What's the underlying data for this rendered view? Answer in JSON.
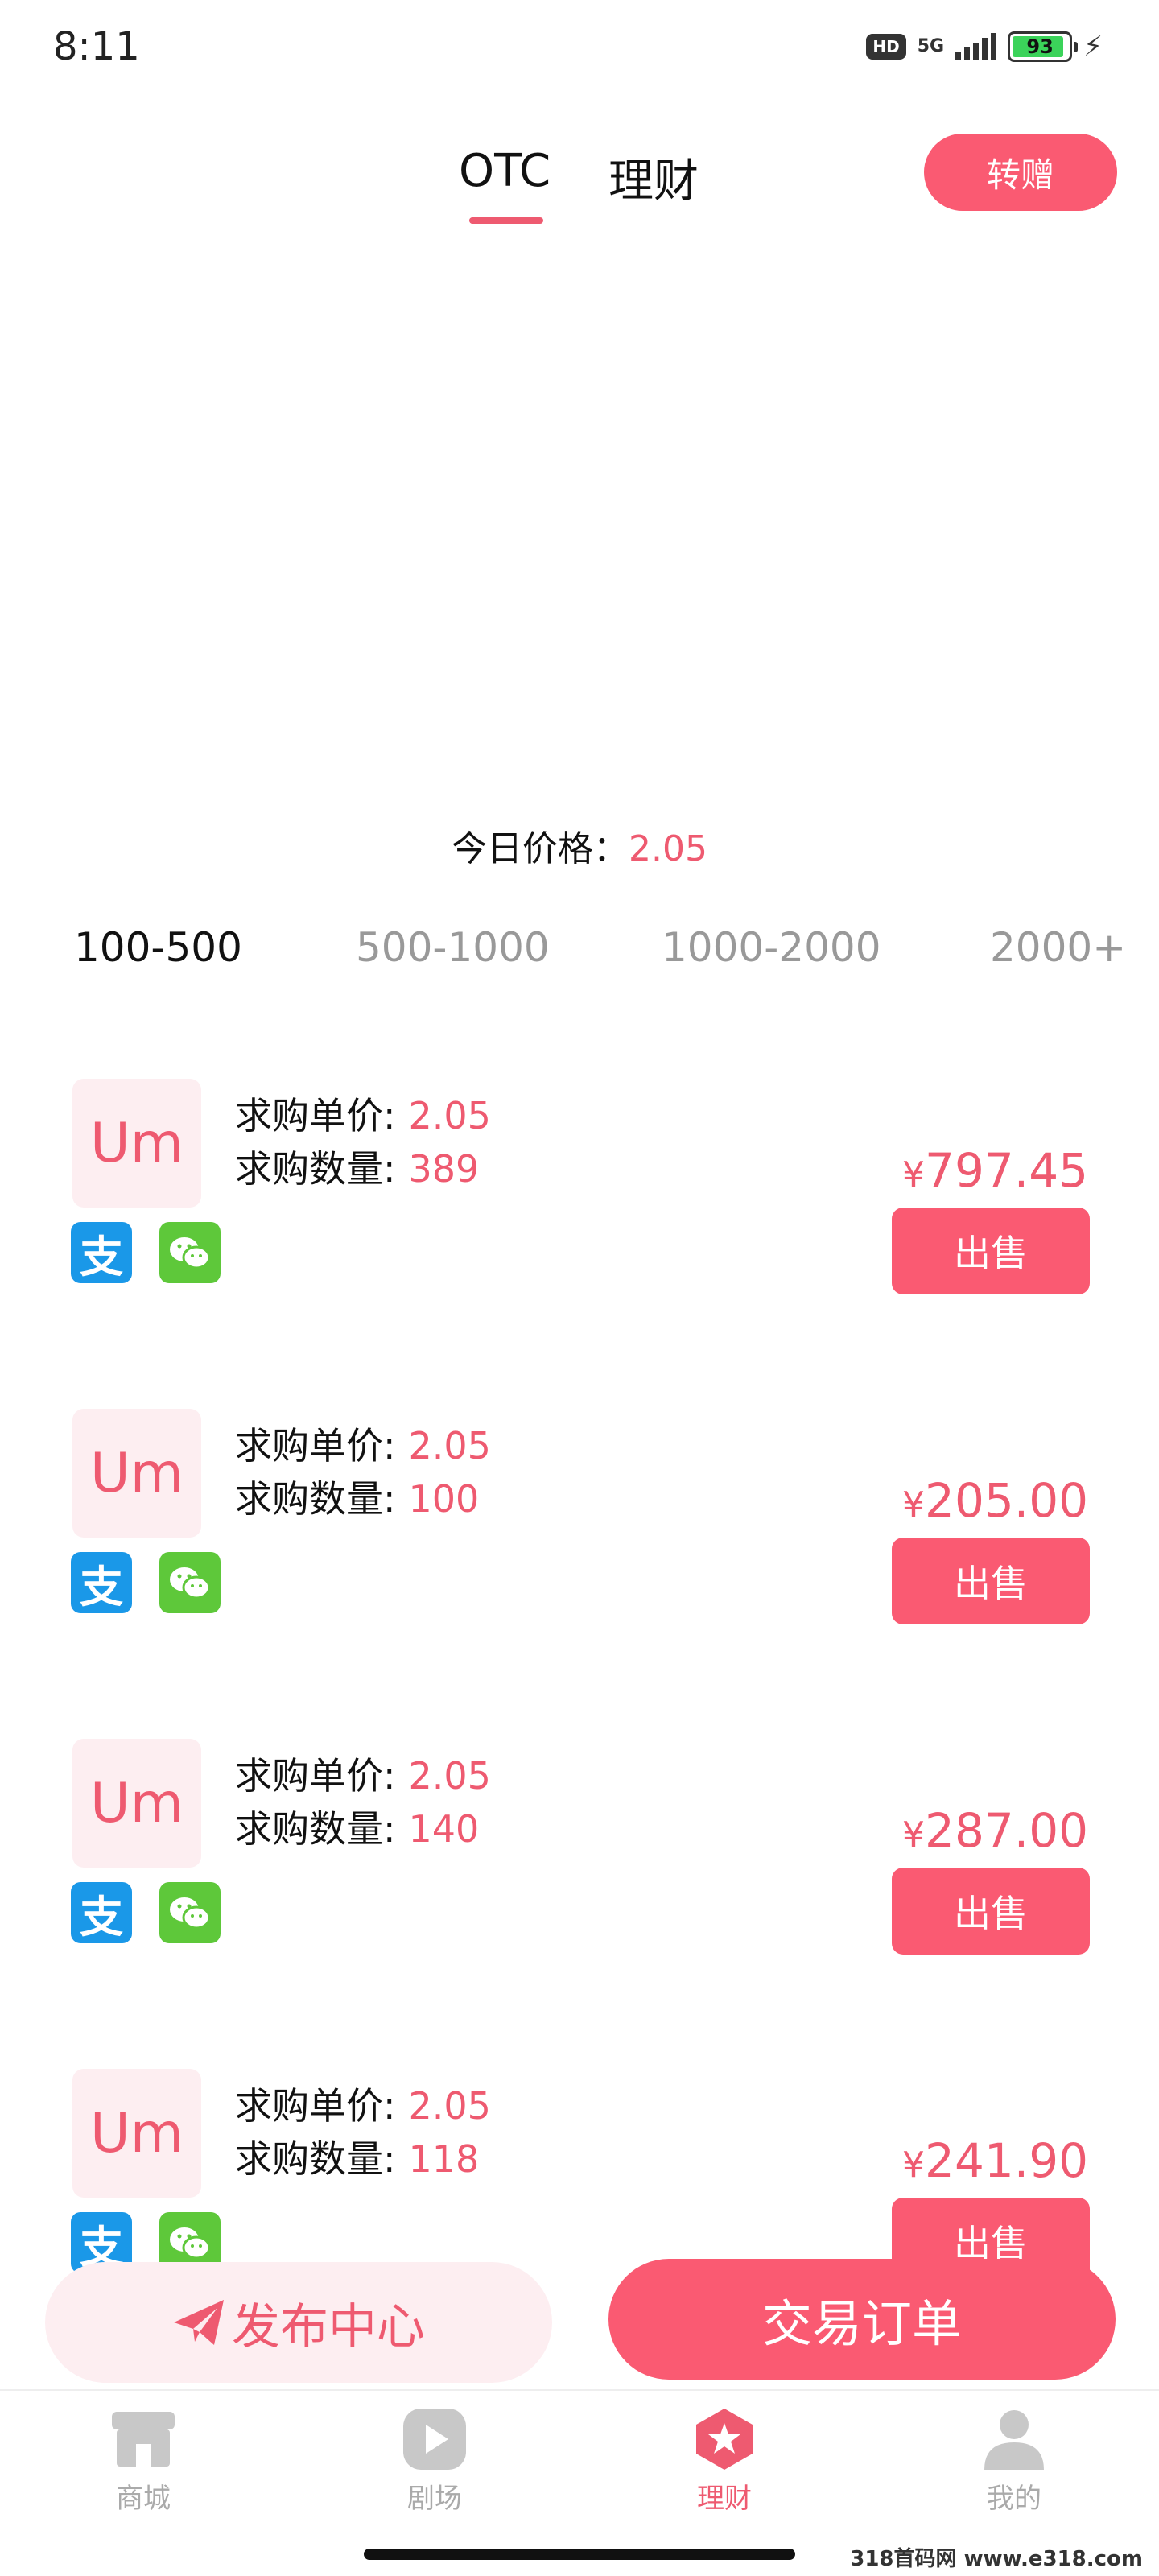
{
  "status_bar": {
    "time": "8:11",
    "hd": "HD",
    "network": "5G",
    "battery": "93",
    "battery_level_percent": 93
  },
  "header": {
    "tabs": [
      {
        "label": "OTC",
        "active": true
      },
      {
        "label": "理财",
        "active": false
      }
    ],
    "gift_label": "转赠"
  },
  "price": {
    "label": "今日价格：",
    "value": "2.05"
  },
  "ranges": [
    {
      "label": "100-500",
      "active": true
    },
    {
      "label": "500-1000",
      "active": false
    },
    {
      "label": "1000-2000",
      "active": false
    },
    {
      "label": "2000+",
      "active": false
    }
  ],
  "orders": [
    {
      "avatar": "Um",
      "unit_price_label": "求购单价:",
      "unit_price": "2.05",
      "quantity_label": "求购数量:",
      "quantity": "389",
      "yen": "¥",
      "total": "797.45",
      "sell_label": "出售"
    },
    {
      "avatar": "Um",
      "unit_price_label": "求购单价:",
      "unit_price": "2.05",
      "quantity_label": "求购数量:",
      "quantity": "100",
      "yen": "¥",
      "total": "205.00",
      "sell_label": "出售"
    },
    {
      "avatar": "Um",
      "unit_price_label": "求购单价:",
      "unit_price": "2.05",
      "quantity_label": "求购数量:",
      "quantity": "140",
      "yen": "¥",
      "total": "287.00",
      "sell_label": "出售"
    },
    {
      "avatar": "Um",
      "unit_price_label": "求购单价:",
      "unit_price": "2.05",
      "quantity_label": "求购数量:",
      "quantity": "118",
      "yen": "¥",
      "total": "241.90",
      "sell_label": "出售"
    }
  ],
  "payment_icons": {
    "alipay_glyph": "支"
  },
  "actions": {
    "publish_label": "发布中心",
    "trade_orders_label": "交易订单"
  },
  "bottom_nav": [
    {
      "label": "商城",
      "icon": "shop-icon",
      "active": false
    },
    {
      "label": "剧场",
      "icon": "play-icon",
      "active": false
    },
    {
      "label": "理财",
      "icon": "star-icon",
      "active": true
    },
    {
      "label": "我的",
      "icon": "user-icon",
      "active": false
    }
  ],
  "watermark": "318首码网 www.e318.com",
  "colors": {
    "accent": "#fa5a72",
    "accent_text": "#ee5a70",
    "accent_light": "#fdeef1",
    "alipay": "#1a98e8",
    "wechat": "#5ec83a",
    "inactive": "#aaaaaa"
  }
}
